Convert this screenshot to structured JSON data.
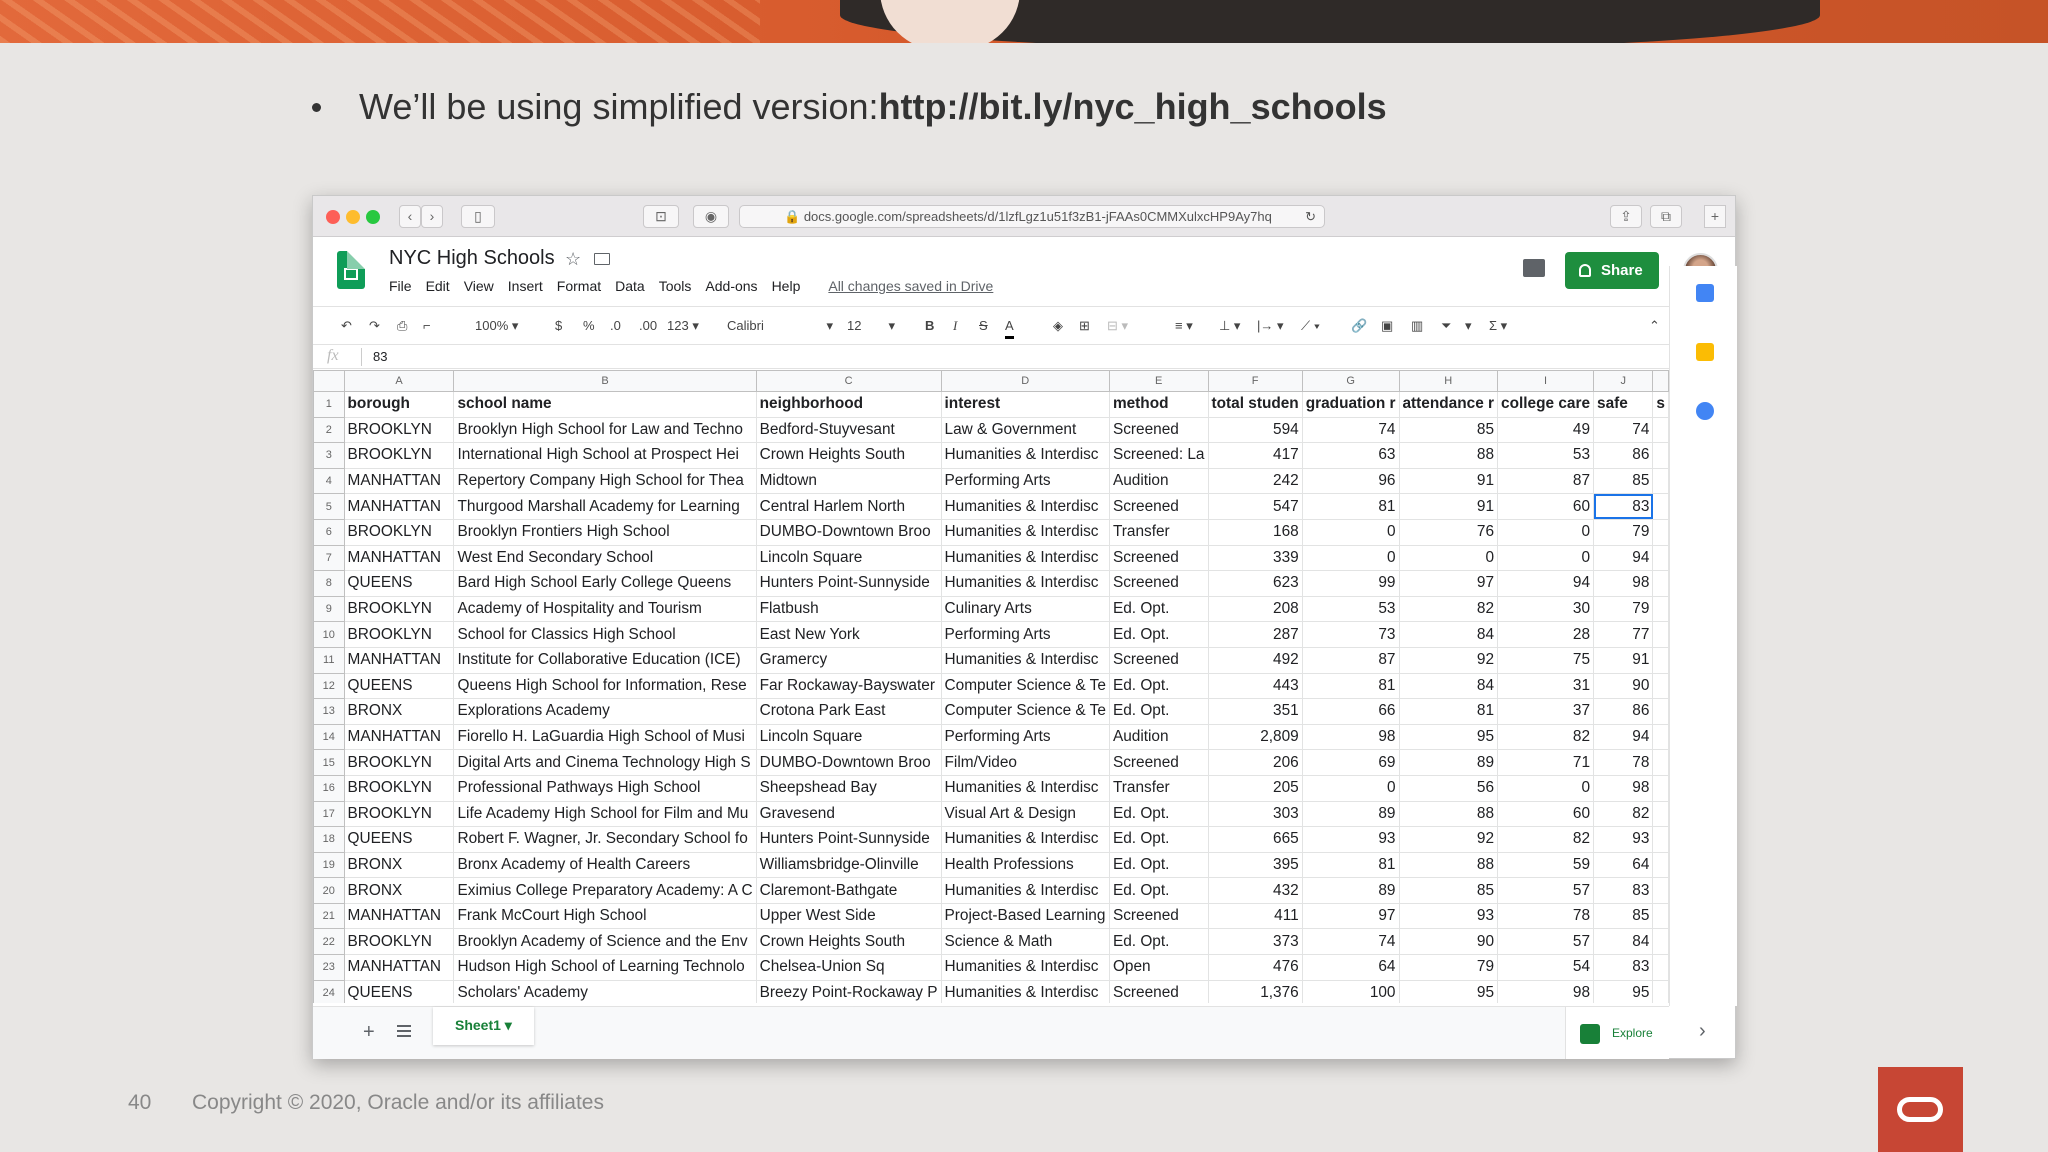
{
  "slide": {
    "bullet_prefix": "We’ll be using simplified version: ",
    "bullet_link": "http://bit.ly/nyc_high_schools",
    "page_number": "40",
    "copyright": "Copyright © 2020, Oracle and/or its affiliates"
  },
  "browser": {
    "url": "docs.google.com/spreadsheets/d/1lzfLgz1u51f3zB1-jFAAs0CMMXulxcHP9Ay7hq"
  },
  "sheets": {
    "title": "NYC High Schools",
    "menus": [
      "File",
      "Edit",
      "View",
      "Insert",
      "Format",
      "Data",
      "Tools",
      "Add-ons",
      "Help"
    ],
    "saved_status": "All changes saved in Drive",
    "share_label": "Share",
    "zoom": "100%",
    "currency": "$",
    "percent": "%",
    "dec_less": ".0",
    "dec_more": ".00",
    "more_formats": "123",
    "font": "Calibri",
    "font_size": "12",
    "fx_label": "fx",
    "formula_value": "83",
    "sheet_tab": "Sheet1",
    "explore_label": "Explore",
    "columns": [
      "A",
      "B",
      "C",
      "D",
      "E",
      "F",
      "G",
      "H",
      "I",
      "J"
    ],
    "header_row": [
      "borough",
      "school name",
      "neighborhood",
      "interest",
      "method",
      "total studen",
      "graduation r",
      "attendance r",
      "college care",
      "safe",
      "s"
    ],
    "rows": [
      [
        "BROOKLYN",
        "Brooklyn High School for Law and Techno",
        "Bedford-Stuyvesant",
        "Law & Government",
        "Screened",
        "594",
        "74",
        "85",
        "49",
        "74"
      ],
      [
        "BROOKLYN",
        "International High School at Prospect Hei",
        "Crown Heights South",
        "Humanities & Interdisc",
        "Screened: La",
        "417",
        "63",
        "88",
        "53",
        "86"
      ],
      [
        "MANHATTAN",
        "Repertory Company High School for Thea",
        "Midtown",
        "Performing Arts",
        "Audition",
        "242",
        "96",
        "91",
        "87",
        "85"
      ],
      [
        "MANHATTAN",
        "Thurgood Marshall Academy for Learning",
        "Central Harlem North",
        "Humanities & Interdisc",
        "Screened",
        "547",
        "81",
        "91",
        "60",
        "83"
      ],
      [
        "BROOKLYN",
        "Brooklyn Frontiers High School",
        "DUMBO-Downtown Broo",
        "Humanities & Interdisc",
        "Transfer",
        "168",
        "0",
        "76",
        "0",
        "79"
      ],
      [
        "MANHATTAN",
        "West End Secondary School",
        "Lincoln Square",
        "Humanities & Interdisc",
        "Screened",
        "339",
        "0",
        "0",
        "0",
        "94"
      ],
      [
        "QUEENS",
        "Bard High School Early College Queens",
        "Hunters Point-Sunnyside",
        "Humanities & Interdisc",
        "Screened",
        "623",
        "99",
        "97",
        "94",
        "98"
      ],
      [
        "BROOKLYN",
        "Academy of Hospitality and Tourism",
        "Flatbush",
        "Culinary Arts",
        "Ed. Opt.",
        "208",
        "53",
        "82",
        "30",
        "79"
      ],
      [
        "BROOKLYN",
        "School for Classics High School",
        "East New York",
        "Performing Arts",
        "Ed. Opt.",
        "287",
        "73",
        "84",
        "28",
        "77"
      ],
      [
        "MANHATTAN",
        "Institute for Collaborative Education (ICE)",
        "Gramercy",
        "Humanities & Interdisc",
        "Screened",
        "492",
        "87",
        "92",
        "75",
        "91"
      ],
      [
        "QUEENS",
        "Queens High School for Information, Rese",
        "Far Rockaway-Bayswater",
        "Computer Science & Te",
        "Ed. Opt.",
        "443",
        "81",
        "84",
        "31",
        "90"
      ],
      [
        "BRONX",
        "Explorations Academy",
        "Crotona Park East",
        "Computer Science & Te",
        "Ed. Opt.",
        "351",
        "66",
        "81",
        "37",
        "86"
      ],
      [
        "MANHATTAN",
        "Fiorello H. LaGuardia High School of Musi",
        "Lincoln Square",
        "Performing Arts",
        "Audition",
        "2,809",
        "98",
        "95",
        "82",
        "94"
      ],
      [
        "BROOKLYN",
        "Digital Arts and Cinema Technology High S",
        "DUMBO-Downtown Broo",
        "Film/Video",
        "Screened",
        "206",
        "69",
        "89",
        "71",
        "78"
      ],
      [
        "BROOKLYN",
        "Professional Pathways High School",
        "Sheepshead Bay",
        "Humanities & Interdisc",
        "Transfer",
        "205",
        "0",
        "56",
        "0",
        "98"
      ],
      [
        "BROOKLYN",
        "Life Academy High School for Film and Mu",
        "Gravesend",
        "Visual Art & Design",
        "Ed. Opt.",
        "303",
        "89",
        "88",
        "60",
        "82"
      ],
      [
        "QUEENS",
        "Robert F. Wagner, Jr. Secondary School fo",
        "Hunters Point-Sunnyside",
        "Humanities & Interdisc",
        "Ed. Opt.",
        "665",
        "93",
        "92",
        "82",
        "93"
      ],
      [
        "BRONX",
        "Bronx Academy of Health Careers",
        "Williamsbridge-Olinville",
        "Health Professions",
        "Ed. Opt.",
        "395",
        "81",
        "88",
        "59",
        "64"
      ],
      [
        "BRONX",
        "Eximius College Preparatory Academy: A C",
        "Claremont-Bathgate",
        "Humanities & Interdisc",
        "Ed. Opt.",
        "432",
        "89",
        "85",
        "57",
        "83"
      ],
      [
        "MANHATTAN",
        "Frank McCourt High School",
        "Upper West Side",
        "Project-Based Learning",
        "Screened",
        "411",
        "97",
        "93",
        "78",
        "85"
      ],
      [
        "BROOKLYN",
        "Brooklyn Academy of Science and the Env",
        "Crown Heights South",
        "Science & Math",
        "Ed. Opt.",
        "373",
        "74",
        "90",
        "57",
        "84"
      ],
      [
        "MANHATTAN",
        "Hudson High School of Learning Technolo",
        "Chelsea-Union Sq",
        "Humanities & Interdisc",
        "Open",
        "476",
        "64",
        "79",
        "54",
        "83"
      ],
      [
        "QUEENS",
        "Scholars' Academy",
        "Breezy Point-Rockaway P",
        "Humanities & Interdisc",
        "Screened",
        "1,376",
        "100",
        "95",
        "98",
        "95"
      ]
    ]
  }
}
